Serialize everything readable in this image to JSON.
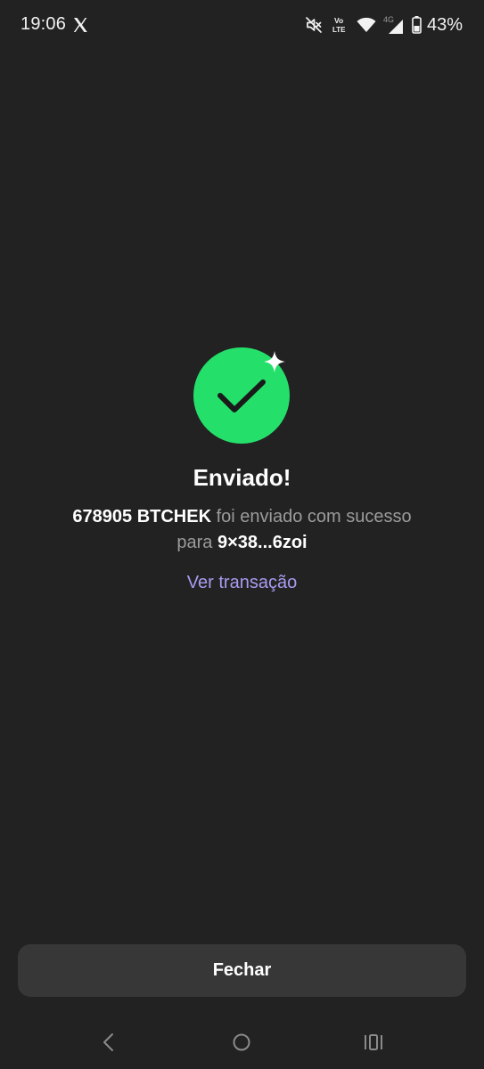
{
  "status_bar": {
    "time": "19:06",
    "battery_percent": "43%",
    "network_label": "4G",
    "volte_label_top": "Vo",
    "volte_label_bottom": "LTE",
    "icons": [
      "x-app-icon",
      "mute-icon",
      "volte-icon",
      "wifi-icon",
      "signal-icon",
      "battery-icon"
    ]
  },
  "success": {
    "icon": "checkmark-icon",
    "accent_color": "#24e06a",
    "title": "Enviado!",
    "amount": "678905 BTCHEK",
    "text_middle": " foi enviado com sucesso para ",
    "recipient": "9×38...6zoi",
    "link_label": "Ver transação"
  },
  "footer": {
    "close_label": "Fechar"
  },
  "nav": {
    "icons": [
      "back-icon",
      "home-icon",
      "recents-icon"
    ]
  }
}
